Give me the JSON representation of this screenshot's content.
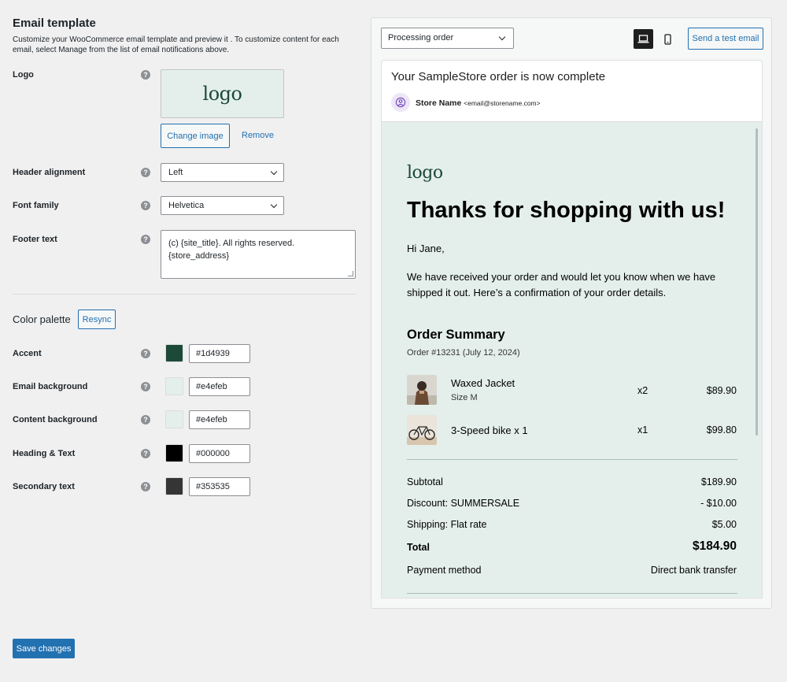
{
  "settings": {
    "title": "Email template",
    "description": "Customize your WooCommerce email template and preview it . To customize content for each email, select Manage from the list of email notifications above.",
    "logo_label": "Logo",
    "logo_text": "logo",
    "change_image_label": "Change image",
    "remove_label": "Remove",
    "header_alignment_label": "Header alignment",
    "header_alignment_value": "Left",
    "font_family_label": "Font family",
    "font_family_value": "Helvetica",
    "footer_text_label": "Footer text",
    "footer_text_line1": "(c) {site_title}. All rights reserved.",
    "footer_text_line2": "{store_address}",
    "help_glyph": "?",
    "color_palette_title": "Color palette",
    "resync_label": "Resync",
    "colors": [
      {
        "label": "Accent",
        "value": "#1d4939"
      },
      {
        "label": "Email background",
        "value": "#e4efeb"
      },
      {
        "label": "Content background",
        "value": "#e4efeb"
      },
      {
        "label": "Heading & Text",
        "value": "#000000"
      },
      {
        "label": "Secondary text",
        "value": "#353535"
      }
    ],
    "save_label": "Save changes"
  },
  "preview": {
    "email_type_value": "Processing order",
    "device_desktop_icon": "laptop-icon",
    "device_mobile_icon": "mobile-icon",
    "send_test_label": "Send a test email",
    "subject": "Your SampleStore order is now complete",
    "sender_name": "Store Name",
    "sender_email": "<email@storename.com>",
    "body": {
      "logo_text": "logo",
      "heading": "Thanks for shopping with us!",
      "greeting": "Hi Jane,",
      "intro": "We have received your order and would let you know when we have shipped it out. Here’s a confirmation of your order details.",
      "summary_title": "Order Summary",
      "order_number": "Order #13231 (July 12, 2024)",
      "items": [
        {
          "name": "Waxed Jacket",
          "variant": "Size M",
          "qty": "x2",
          "price": "$89.90"
        },
        {
          "name": "3-Speed bike x 1",
          "variant": "",
          "qty": "x1",
          "price": "$99.80"
        }
      ],
      "totals": {
        "subtotal_label": "Subtotal",
        "subtotal_value": "$189.90",
        "discount_label": "Discount: SUMMERSALE",
        "discount_value": "- $10.00",
        "shipping_label": "Shipping: Flat rate",
        "shipping_value": "$5.00",
        "total_label": "Total",
        "total_value": "$184.90",
        "payment_label": "Payment method",
        "payment_value": "Direct bank transfer"
      }
    }
  }
}
